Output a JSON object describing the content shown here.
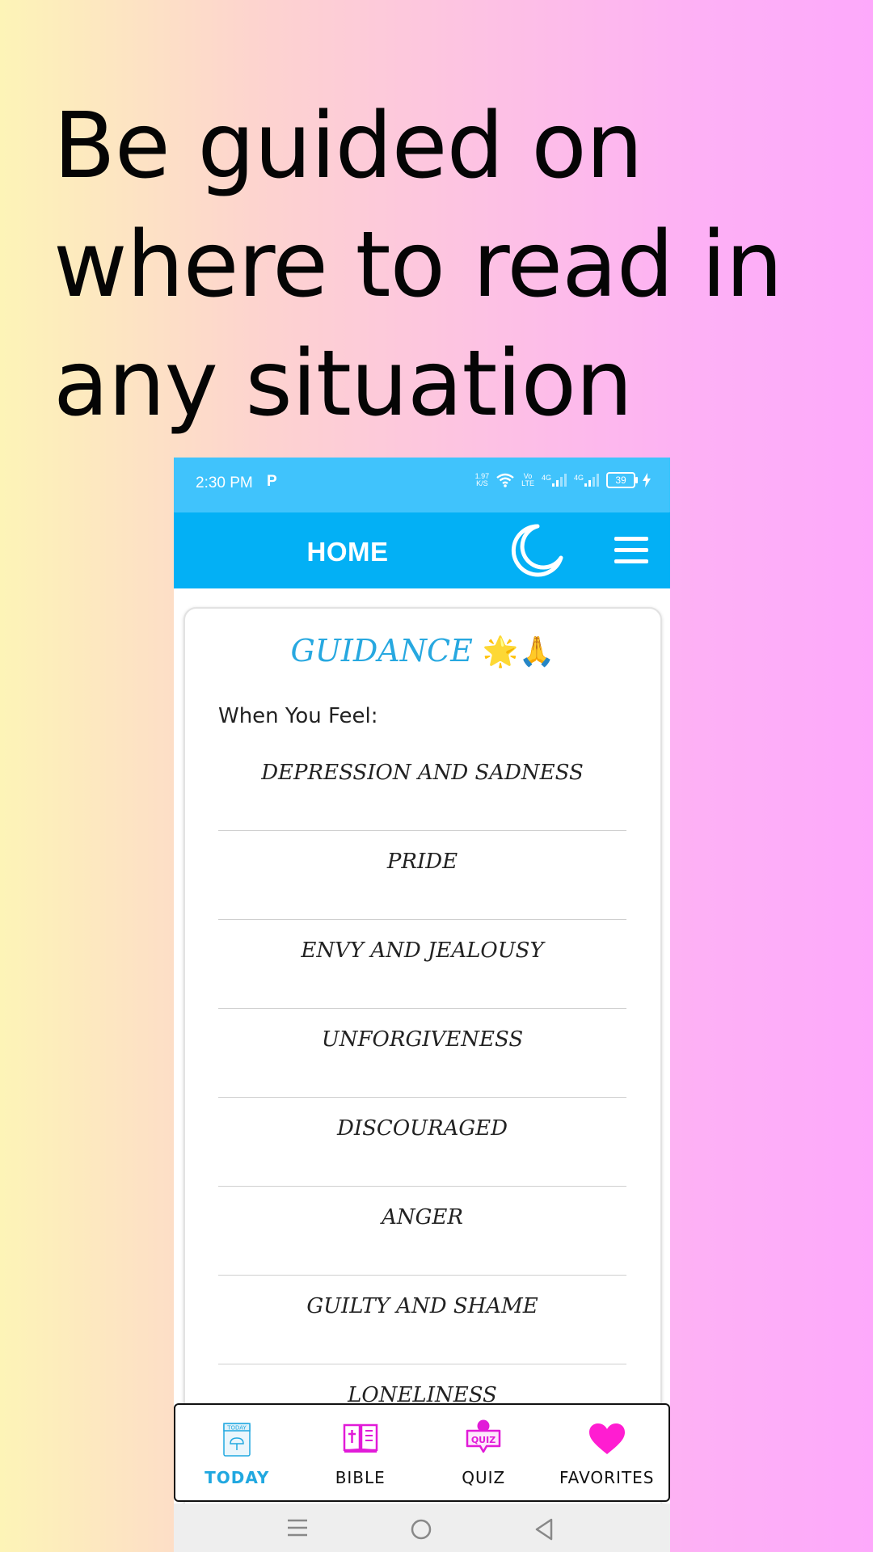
{
  "headline": "Be guided on where to read in any situation",
  "status_bar": {
    "time": "2:30 PM",
    "app_indicator": "P",
    "speed_value": "1.97",
    "speed_unit": "K/S",
    "volte_top": "Vo",
    "volte_bottom": "LTE",
    "network1": "4G",
    "network2": "4G",
    "battery": "39"
  },
  "app_bar": {
    "title": "HOME",
    "moon_icon": "moon-icon",
    "menu_icon": "hamburger-menu-icon"
  },
  "card": {
    "title": "GUIDANCE",
    "title_emojis": "🌟🙏",
    "subtitle": "When You Feel:",
    "items": [
      "DEPRESSION AND SADNESS",
      "PRIDE",
      "ENVY AND JEALOUSY",
      "UNFORGIVENESS",
      "DISCOURAGED",
      "ANGER",
      "GUILTY AND SHAME",
      "LONELINESS"
    ]
  },
  "bottom_nav": {
    "items": [
      {
        "label": "TODAY",
        "icon": "today-calendar-icon",
        "active": true
      },
      {
        "label": "BIBLE",
        "icon": "bible-book-icon",
        "active": false
      },
      {
        "label": "QUIZ",
        "icon": "quiz-bubble-icon",
        "active": false
      },
      {
        "label": "FAVORITES",
        "icon": "heart-icon",
        "active": false
      }
    ],
    "today_icon_text": "TODAY",
    "quiz_icon_text": "QUIZ"
  },
  "colors": {
    "status_bar": "#40c3fc",
    "app_bar": "#03b0f5",
    "accent": "#21a8e0",
    "magenta": "#e11bd8",
    "heart": "#ff1dd1"
  }
}
